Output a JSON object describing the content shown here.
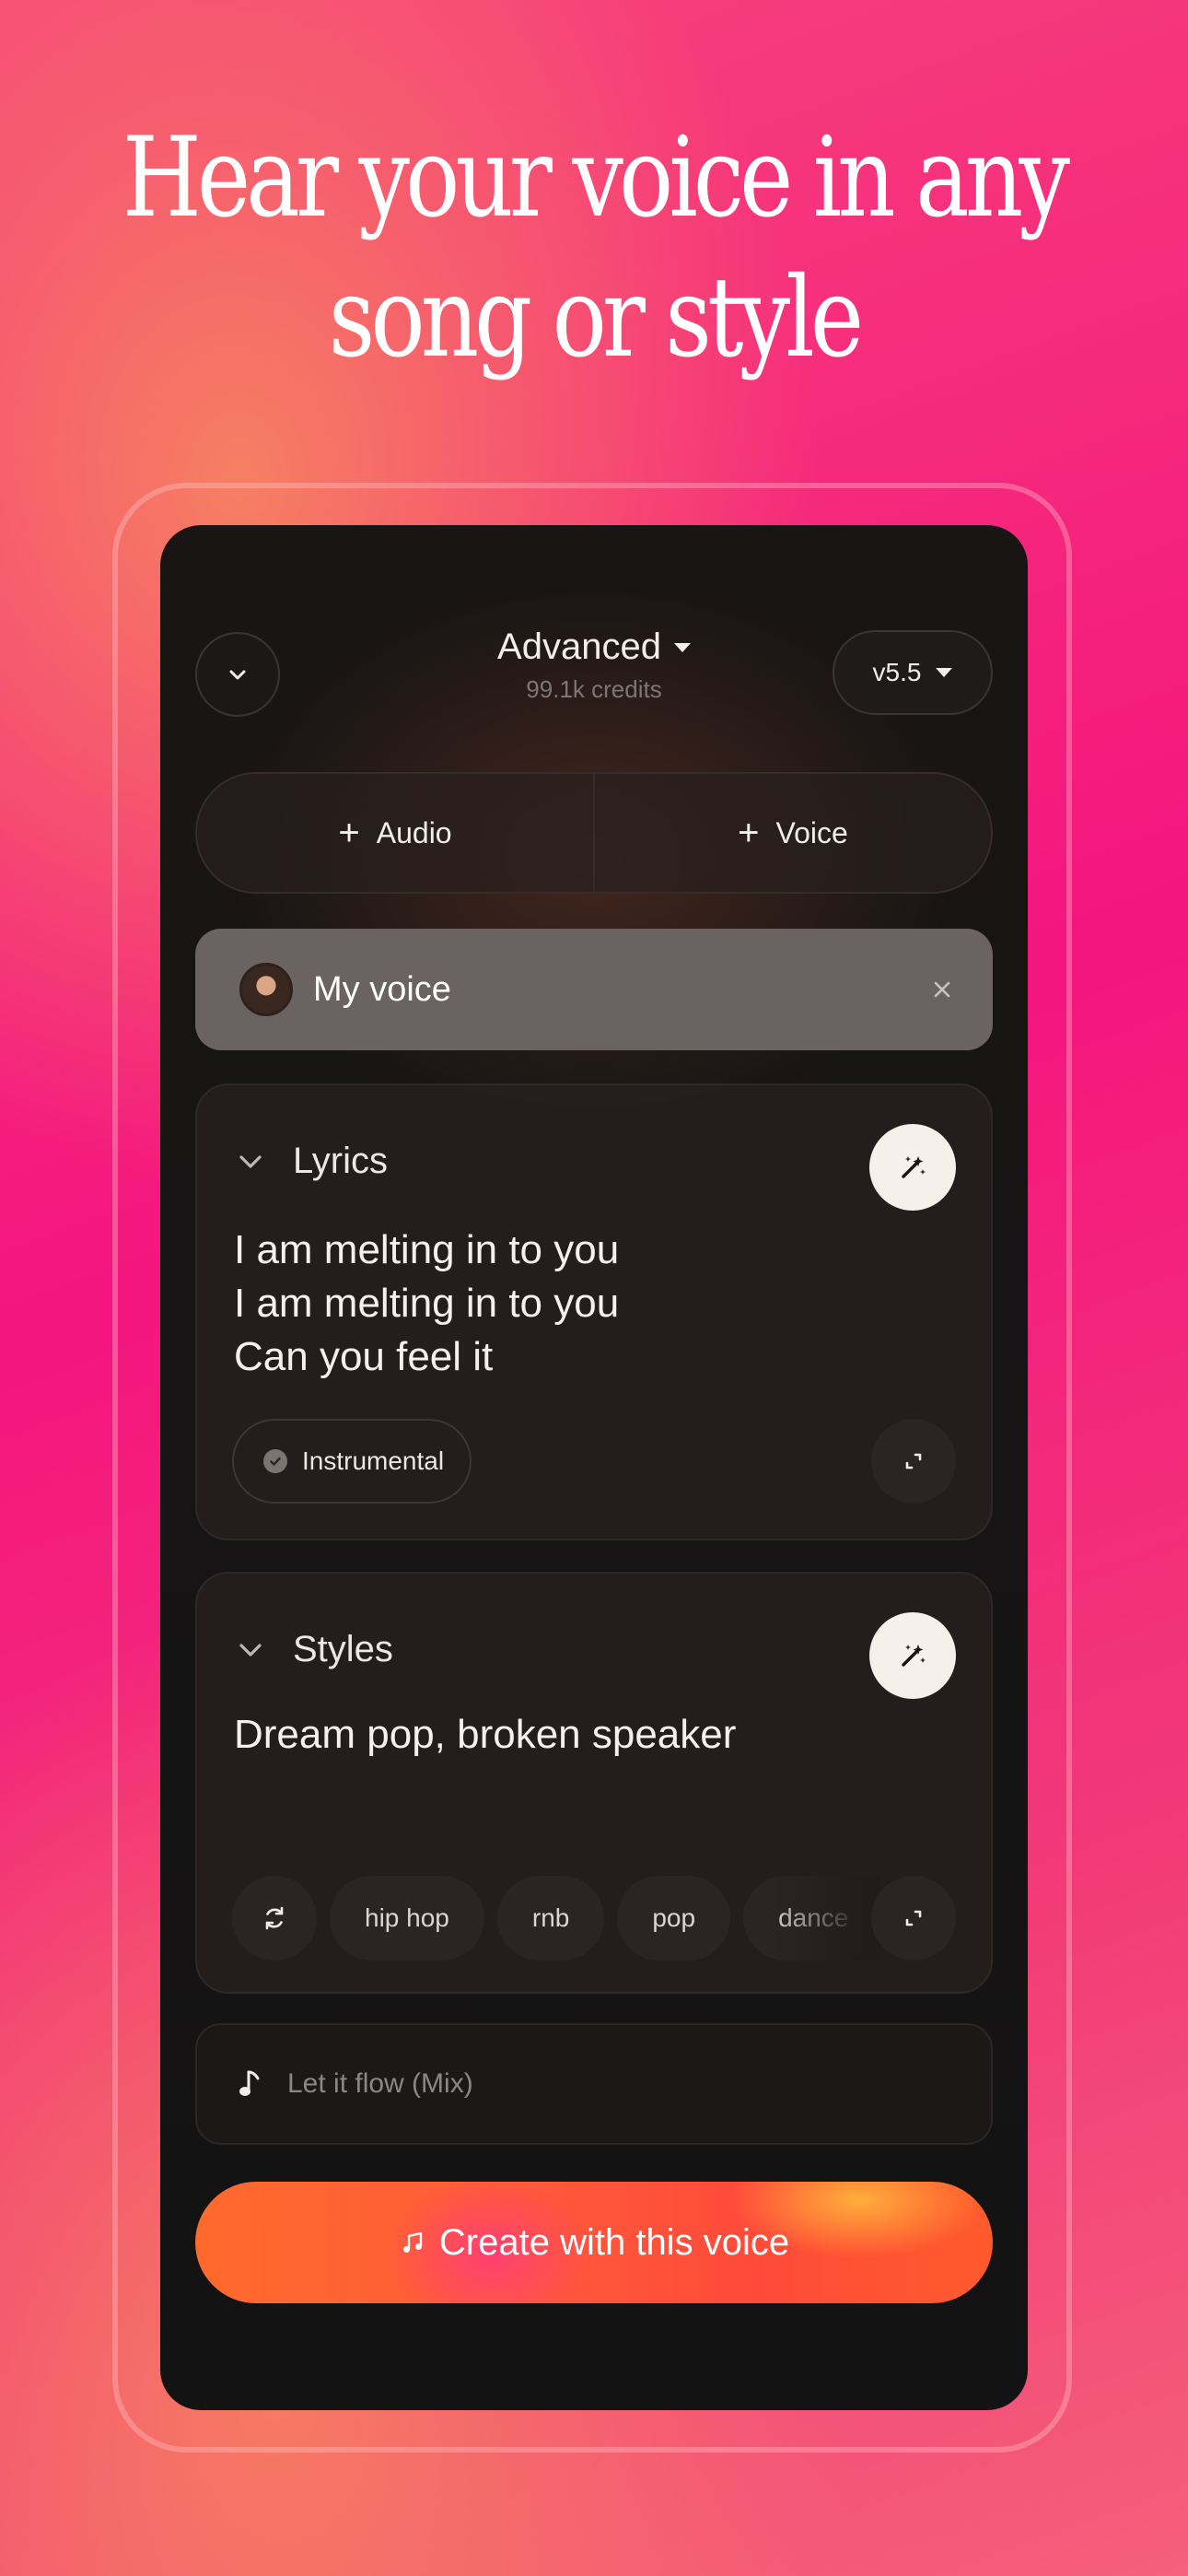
{
  "headline": {
    "line1": "Hear your voice in any",
    "line2": "song or style"
  },
  "header": {
    "mode_label": "Advanced",
    "credits": "99.1k credits",
    "version": "v5.5"
  },
  "add_bar": {
    "audio_label": "Audio",
    "voice_label": "Voice"
  },
  "voice_chip": {
    "label": "My voice"
  },
  "lyrics": {
    "title": "Lyrics",
    "lines": [
      "I am melting in to you",
      "I am melting in to you",
      "Can you feel it"
    ],
    "instrumental_label": "Instrumental"
  },
  "styles": {
    "title": "Styles",
    "text": "Dream pop, broken speaker",
    "tags": [
      "hip hop",
      "rnb",
      "pop",
      "dance"
    ]
  },
  "song_title": {
    "placeholder": "Let it flow (Mix)"
  },
  "create_button": {
    "label": "Create with this voice"
  },
  "colors": {
    "accent": "#ff5a3a",
    "background_pink": "#f4157e",
    "panel": "#161414"
  }
}
